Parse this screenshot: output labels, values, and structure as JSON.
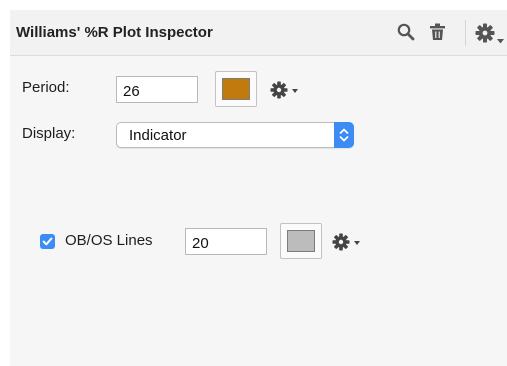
{
  "inspector": {
    "title": "Williams' %R Plot Inspector",
    "header_icons": [
      "search-icon",
      "trash-icon",
      "gear-icon",
      "chevron-down-icon"
    ]
  },
  "period": {
    "label": "Period:",
    "value": "26",
    "color": "#c07a0e"
  },
  "display": {
    "label": "Display:",
    "selected": "Indicator"
  },
  "obos": {
    "checkbox_checked": true,
    "label": "OB/OS Lines",
    "value": "20",
    "color": "#bcbcbc"
  },
  "colors": {
    "accent": "#3b8cf4",
    "panel_background": "#f6f6f6",
    "header_background": "#f2f2f2"
  }
}
